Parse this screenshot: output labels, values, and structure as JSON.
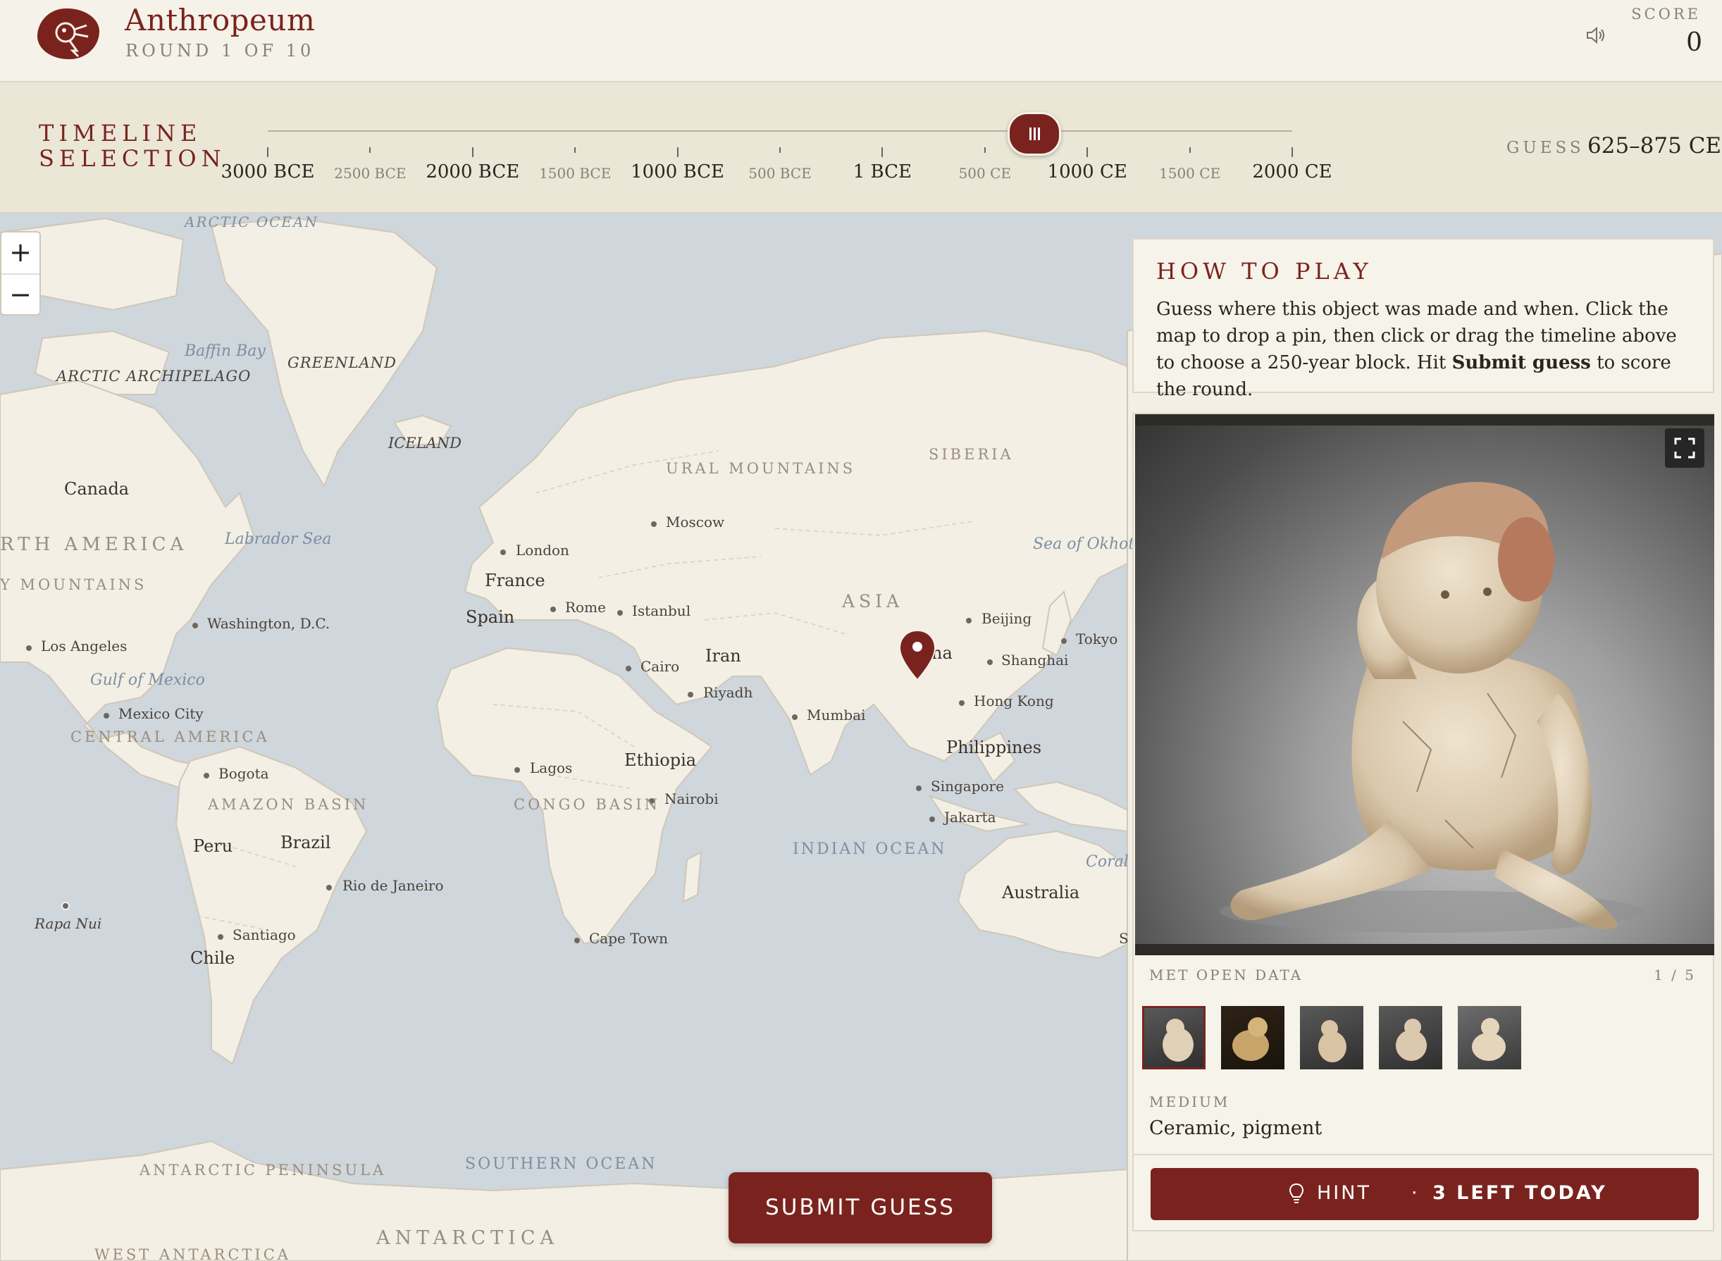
{
  "header": {
    "app_title": "Anthropeum",
    "round_label": "ROUND 1 OF 10",
    "score_label": "SCORE",
    "score_value": "0",
    "icons": {
      "logo": "bird-emblem-icon",
      "sound": "speaker-icon"
    }
  },
  "timeline": {
    "title_line1": "TIMELINE",
    "title_line2": "SELECTION",
    "ticks": [
      {
        "label": "3000 BCE",
        "major": true
      },
      {
        "label": "2500 BCE",
        "major": false
      },
      {
        "label": "2000 BCE",
        "major": true
      },
      {
        "label": "1500 BCE",
        "major": false
      },
      {
        "label": "1000 BCE",
        "major": true
      },
      {
        "label": "500 BCE",
        "major": false
      },
      {
        "label": "1 BCE",
        "major": true
      },
      {
        "label": "500 CE",
        "major": false
      },
      {
        "label": "1000 CE",
        "major": true
      },
      {
        "label": "1500 CE",
        "major": false
      },
      {
        "label": "2000 CE",
        "major": true
      }
    ],
    "selected_range": [
      625,
      875
    ],
    "guess_label": "GUESS",
    "guess_value": "625–875 CE"
  },
  "map": {
    "zoom_in": "+",
    "zoom_out": "−",
    "pin_location": "China",
    "labels": {
      "arctic_ocean": "ARCTIC OCEAN",
      "baffin_bay": "Baffin Bay",
      "greenland": "GREENLAND",
      "arctic_archipelago": "ARCTIC ARCHIPELAGO",
      "iceland": "ICELAND",
      "canada": "Canada",
      "north_america": "RTH AMERICA",
      "labrador_sea": "Labrador Sea",
      "rocky_mountains": "Y MOUNTAINS",
      "washington": "Washington, D.C.",
      "los_angeles": "Los Angeles",
      "gulf_mexico": "Gulf of Mexico",
      "mexico_city": "Mexico City",
      "central_america": "CENTRAL AMERICA",
      "bogota": "Bogota",
      "amazon_basin": "AMAZON BASIN",
      "peru": "Peru",
      "brazil": "Brazil",
      "rio": "Rio de Janeiro",
      "rapa_nui": "Rapa Nui",
      "santiago": "Santiago",
      "chile": "Chile",
      "london": "London",
      "france": "France",
      "spain": "Spain",
      "rome": "Rome",
      "istanbul": "Istanbul",
      "moscow": "Moscow",
      "ural": "URAL MOUNTAINS",
      "siberia": "SIBERIA",
      "sea_okhotsk": "Sea of Okhots",
      "asia": "ASIA",
      "beijing": "Beijing",
      "tokyo": "Tokyo",
      "shanghai": "Shanghai",
      "china": "na",
      "iran": "Iran",
      "cairo": "Cairo",
      "riyadh": "Riyadh",
      "mumbai": "Mumbai",
      "hong_kong": "Hong Kong",
      "philippines": "Philippines",
      "singapore": "Singapore",
      "jakarta": "Jakarta",
      "ethiopia": "Ethiopia",
      "lagos": "Lagos",
      "nairobi": "Nairobi",
      "congo_basin": "CONGO BASIN",
      "indian_ocean": "INDIAN OCEAN",
      "coral": "Coral",
      "australia": "Australia",
      "cape_town": "Cape Town",
      "antarctic_peninsula": "ANTARCTIC PENINSULA",
      "southern_ocean": "SOUTHERN OCEAN",
      "antarctica": "ANTARCTICA",
      "west_antarctica": "WEST ANTARCTICA",
      "s_cut": "S"
    }
  },
  "submit_label": "SUBMIT GUESS",
  "how_to_play": {
    "title": "HOW TO PLAY",
    "text_before": "Guess where this object was made and when. Click the map to drop a pin, then click or drag the timeline above to choose a 250-year block. Hit ",
    "text_bold": "Submit guess",
    "text_after": " to score the round."
  },
  "object": {
    "source_label": "MET OPEN DATA",
    "image_counter": "1 / 5",
    "thumbnail_count": 5,
    "active_thumbnail": 1,
    "medium_label": "MEDIUM",
    "medium_value": "Ceramic, pigment",
    "expand_icon": "fullscreen-icon"
  },
  "hint": {
    "label": "HINT",
    "separator": "·",
    "remaining": "3 LEFT TODAY",
    "icon": "lightbulb-icon"
  },
  "colors": {
    "accent": "#7a231e",
    "background": "#f4f1e8",
    "ocean": "#cfd6dc",
    "land": "#f3efe5"
  }
}
